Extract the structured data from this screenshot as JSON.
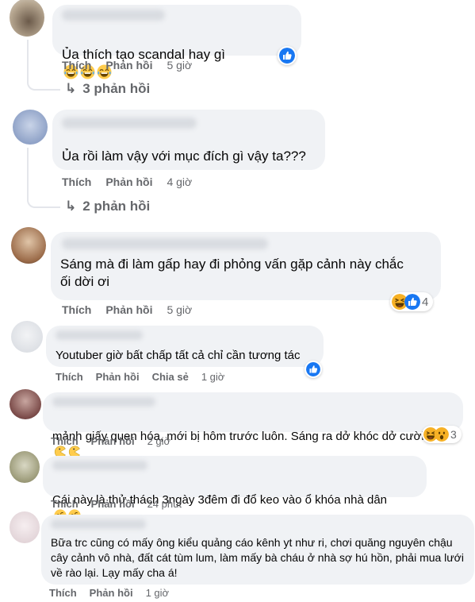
{
  "actions": {
    "like_label": "Thích",
    "reply_label": "Phản hồi",
    "share_label": "Chia sẻ"
  },
  "comments": [
    {
      "text": "Ủa thích tạo scandal hay gì",
      "inline_emoji": [
        "laughing-tears-emoji",
        "laughing-tears-emoji",
        "laughing-tears-emoji"
      ],
      "time": "5 giờ",
      "reactions": [
        "like"
      ],
      "reaction_count": "",
      "replies_label": "3 phản hồi"
    },
    {
      "text": "Ủa rồi làm vậy với mục đích gì vậy ta???",
      "time": "4 giờ",
      "reactions": [],
      "replies_label": "2 phản hồi"
    },
    {
      "text": "Sáng mà đi làm gấp hay đi phỏng vấn gặp cảnh này chắc\nối dời ơi",
      "time": "5 giờ",
      "reactions": [
        "haha",
        "like"
      ],
      "reaction_count": "4"
    },
    {
      "text": "Youtuber giờ bất chấp tất cả chỉ cần tương tác",
      "time": "1 giờ",
      "reactions": [
        "like"
      ],
      "reaction_count": "",
      "has_share": true
    },
    {
      "text": "mảnh giấy quen hóa, mới bị hôm trước luôn. Sáng ra dở khóc dở cười",
      "inline_emoji": [
        "pacman-emoji",
        "pacman-emoji"
      ],
      "time": "2 giờ",
      "reactions": [
        "haha",
        "wow"
      ],
      "reaction_count": "3"
    },
    {
      "text": "Cái này là thử thách 3ngày 3đêm đi đổ keo vào ổ khóa nhà dân",
      "inline_emoji": [
        "rolling-laughing-emoji",
        "rolling-laughing-emoji"
      ],
      "time": "24 phút"
    },
    {
      "text": "Bữa trc cũng có mấy ông kiểu quảng cáo kênh yt như ri, chơi quăng nguyên chậu\ncây cảnh vô nhà, đất cát tùm lum, làm mấy bà cháu ở nhà sợ hú hồn, phải mua lưới\nvề rào lại. Lạy mấy cha á!",
      "time": "1 giờ"
    }
  ],
  "colors": {
    "bubble": "#f0f2f5",
    "meta_text": "#65676b",
    "like_blue": "#1877f2",
    "haha_yellow": "#f7b125"
  }
}
